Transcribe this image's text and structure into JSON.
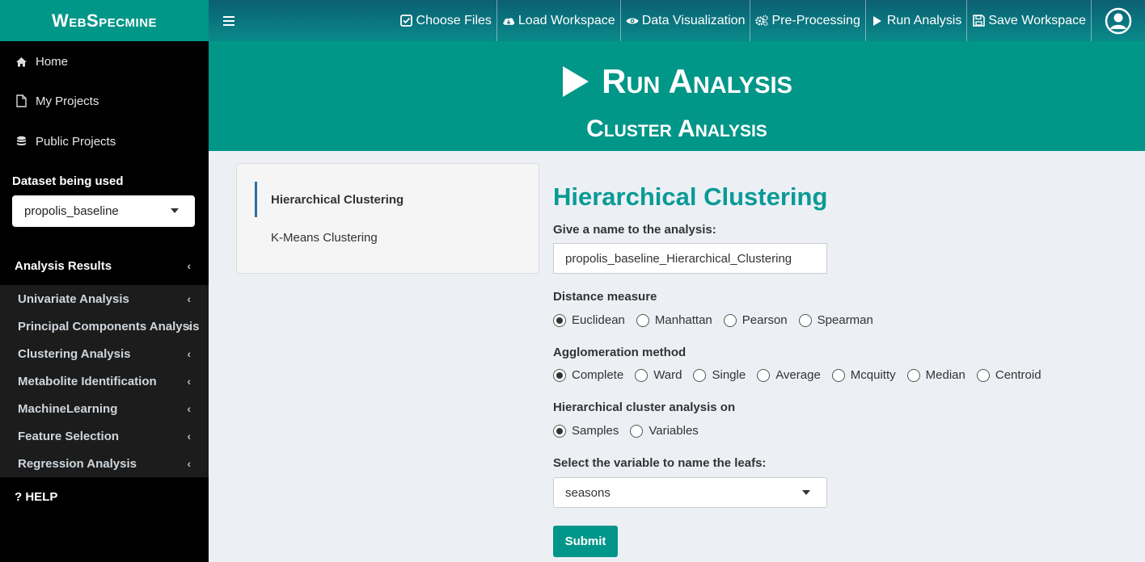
{
  "app": {
    "logo": "WebSpecmine"
  },
  "topnav": {
    "items": [
      {
        "label": "Choose Files",
        "icon": "check-square-icon"
      },
      {
        "label": "Load Workspace",
        "icon": "cloud-download-icon"
      },
      {
        "label": "Data Visualization",
        "icon": "eye-icon"
      },
      {
        "label": "Pre-Processing",
        "icon": "gears-icon"
      },
      {
        "label": "Run Analysis",
        "icon": "play-icon"
      },
      {
        "label": "Save Workspace",
        "icon": "floppy-icon"
      }
    ]
  },
  "sidebar": {
    "links": [
      {
        "label": "Home",
        "icon": "home-icon"
      },
      {
        "label": "My Projects",
        "icon": "file-icon"
      },
      {
        "label": "Public Projects",
        "icon": "database-icon"
      }
    ],
    "dataset_label": "Dataset being used",
    "dataset_value": "propolis_baseline",
    "analysis_results_label": "Analysis Results",
    "submenu": [
      "Univariate Analysis",
      "Principal Components Analysis",
      "Clustering Analysis",
      "Metabolite Identification",
      "MachineLearning",
      "Feature Selection",
      "Regression Analysis"
    ],
    "help": "HELP"
  },
  "banner": {
    "title": "Run Analysis",
    "subtitle": "Cluster Analysis"
  },
  "tabs": [
    {
      "label": "Hierarchical Clustering",
      "active": true
    },
    {
      "label": "K-Means Clustering",
      "active": false
    }
  ],
  "form": {
    "heading": "Hierarchical Clustering",
    "name_label": "Give a name to the analysis:",
    "name_value": "propolis_baseline_Hierarchical_Clustering",
    "distance_label": "Distance measure",
    "distance_options": [
      "Euclidean",
      "Manhattan",
      "Pearson",
      "Spearman"
    ],
    "distance_selected": "Euclidean",
    "agglomeration_label": "Agglomeration method",
    "agglomeration_options": [
      "Complete",
      "Ward",
      "Single",
      "Average",
      "Mcquitty",
      "Median",
      "Centroid"
    ],
    "agglomeration_selected": "Complete",
    "on_label": "Hierarchical cluster analysis on",
    "on_options": [
      "Samples",
      "Variables"
    ],
    "on_selected": "Samples",
    "leafs_label": "Select the variable to name the leafs:",
    "leafs_value": "seasons",
    "submit_label": "Submit"
  },
  "colors": {
    "accent": "#009688",
    "heading": "#0a9a96",
    "sidebar_bg": "#000000",
    "content_bg": "#ecf0f5"
  }
}
